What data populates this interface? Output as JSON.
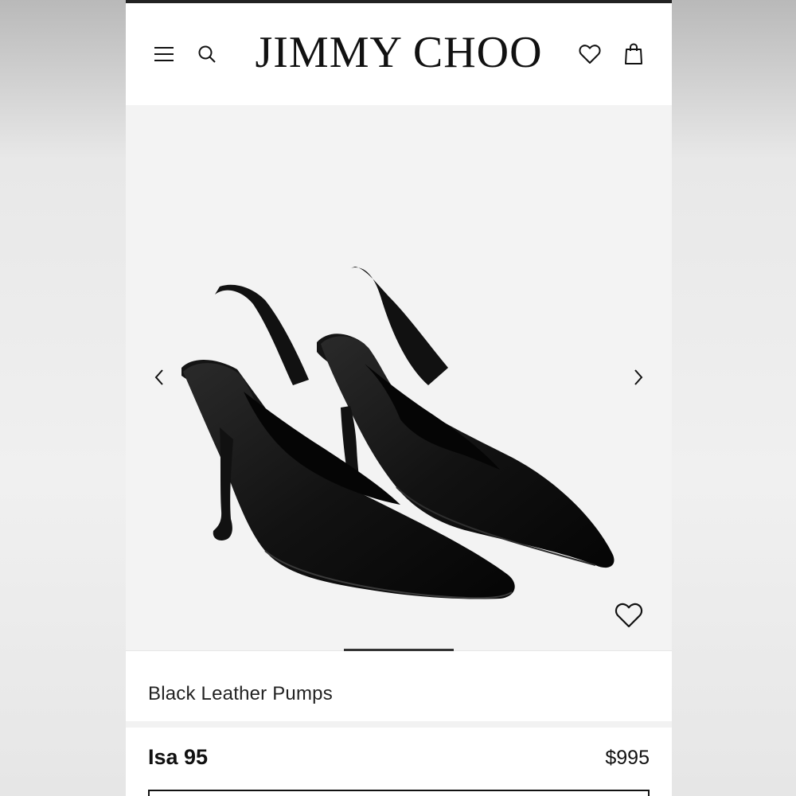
{
  "header": {
    "brand": "JIMMY CHOO",
    "icons": [
      "menu-icon",
      "search-icon",
      "heart-icon",
      "shopping-bag-icon"
    ]
  },
  "product": {
    "subtitle": "Black Leather Pumps",
    "name": "Isa 95",
    "price": "$995"
  },
  "gallery": {
    "image_description_icon": "product-image",
    "active_slide": 1
  },
  "colors": {
    "accent": "#111111",
    "hero_bg": "#f3f3f3"
  }
}
